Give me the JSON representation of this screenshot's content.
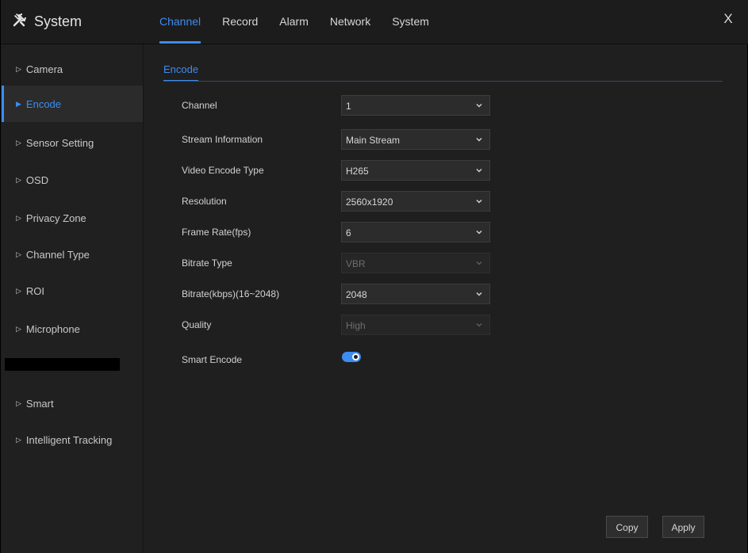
{
  "header": {
    "title": "System",
    "tabs": [
      {
        "label": "Channel",
        "active": true
      },
      {
        "label": "Record",
        "active": false
      },
      {
        "label": "Alarm",
        "active": false
      },
      {
        "label": "Network",
        "active": false
      },
      {
        "label": "System",
        "active": false
      }
    ],
    "close_label": "X"
  },
  "sidebar": {
    "items": [
      {
        "label": "Camera",
        "active": false
      },
      {
        "label": "Encode",
        "active": true
      },
      {
        "label": "Sensor Setting",
        "active": false
      },
      {
        "label": "OSD",
        "active": false
      },
      {
        "label": "Privacy Zone",
        "active": false
      },
      {
        "label": "Channel Type",
        "active": false
      },
      {
        "label": "ROI",
        "active": false
      },
      {
        "label": "Microphone",
        "active": false
      },
      {
        "label": "Smart",
        "active": false
      },
      {
        "label": "Intelligent Tracking",
        "active": false
      }
    ]
  },
  "main": {
    "sub_tab": "Encode",
    "fields": [
      {
        "label": "Channel",
        "value": "1",
        "disabled": false
      },
      {
        "label": "Stream Information",
        "value": "Main Stream",
        "disabled": false
      },
      {
        "label": "Video Encode Type",
        "value": "H265",
        "disabled": false
      },
      {
        "label": "Resolution",
        "value": "2560x1920",
        "disabled": false
      },
      {
        "label": "Frame Rate(fps)",
        "value": "6",
        "disabled": false
      },
      {
        "label": "Bitrate Type",
        "value": "VBR",
        "disabled": true
      },
      {
        "label": "Bitrate(kbps)(16~2048)",
        "value": "2048",
        "disabled": false
      },
      {
        "label": "Quality",
        "value": "High",
        "disabled": true
      }
    ],
    "smart_encode": {
      "label": "Smart Encode",
      "enabled": true
    }
  },
  "footer": {
    "copy_label": "Copy",
    "apply_label": "Apply"
  },
  "colors": {
    "accent": "#3d8cf0",
    "background": "#1f1f1f"
  }
}
